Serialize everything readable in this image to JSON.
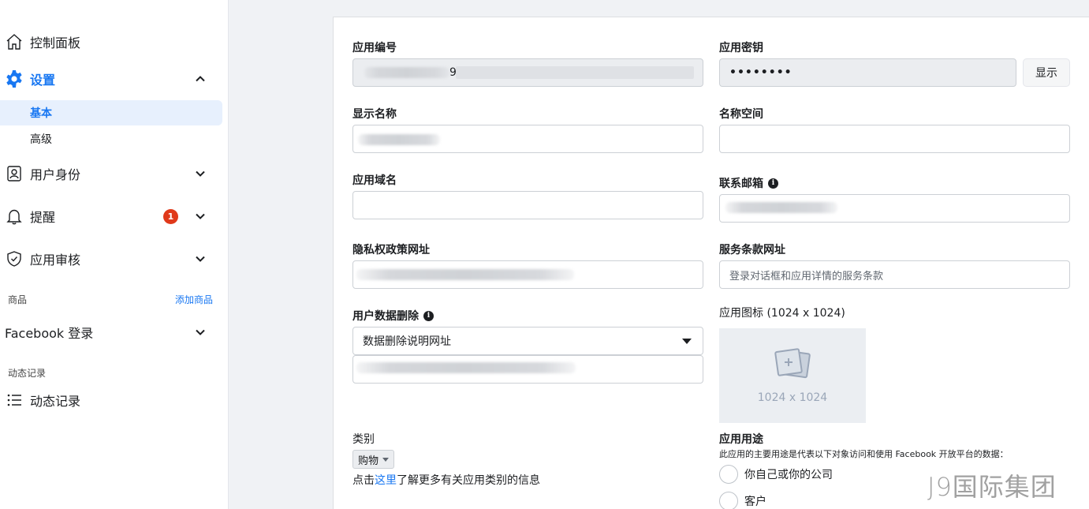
{
  "sidebar": {
    "dashboard": "控制面板",
    "settings": "设置",
    "settings_sub": [
      "基本",
      "高级"
    ],
    "roles": "用户身份",
    "alerts": "提醒",
    "alerts_badge": "1",
    "app_review": "应用审核",
    "products_head": "商品",
    "add_product": "添加商品",
    "facebook_login": "Facebook 登录",
    "activity_head": "动态记录",
    "activity_log": "动态记录"
  },
  "form": {
    "app_id_label": "应用编号",
    "app_id_value": "9",
    "app_secret_label": "应用密钥",
    "app_secret_value": "••••••••",
    "show_button": "显示",
    "display_name_label": "显示名称",
    "namespace_label": "名称空间",
    "app_domains_label": "应用域名",
    "contact_email_label": "联系邮箱",
    "privacy_url_label": "隐私权政策网址",
    "tos_url_label": "服务条款网址",
    "tos_url_placeholder": "登录对话框和应用详情的服务条款",
    "data_deletion_label": "用户数据删除",
    "data_deletion_select": "数据删除说明网址",
    "app_icon_label": "应用图标 (1024 x 1024)",
    "app_icon_placeholder": "1024 x 1024",
    "category_label": "类别",
    "category_value": "购物",
    "category_info_prefix": "点击",
    "category_info_link": "这里",
    "category_info_suffix": "了解更多有关应用类别的信息",
    "purpose_label": "应用用途",
    "purpose_hint": "此应用的主要用途是代表以下对象访问和使用 Facebook 开放平台的数据：",
    "purpose_options": [
      "你自己或你的公司",
      "客户"
    ]
  },
  "watermark": "J9国际集团",
  "colors": {
    "accent": "#1877f2",
    "badge": "#e0391a",
    "page_bg": "#f0f2f5"
  }
}
